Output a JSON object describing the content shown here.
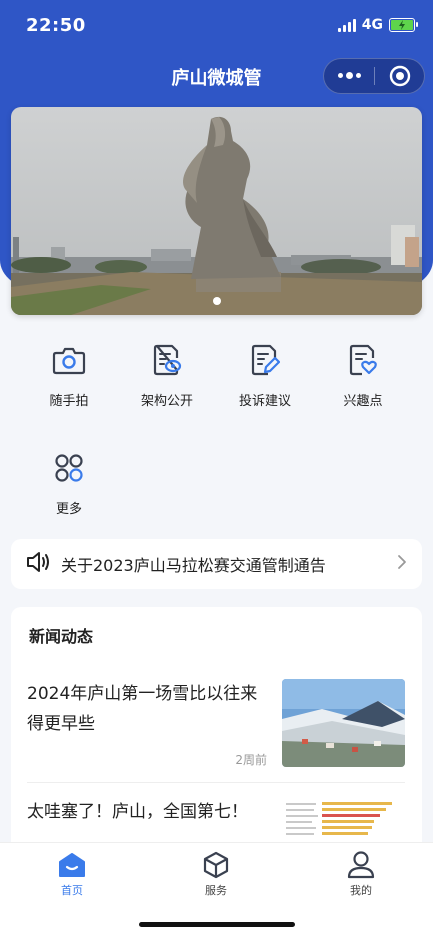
{
  "status_bar": {
    "time": "22:50",
    "network": "4G"
  },
  "header": {
    "title": "庐山微城管"
  },
  "banner": {
    "image": "statue-photo",
    "slides": 1,
    "active_slide": 1
  },
  "services": [
    {
      "label": "随手拍",
      "icon": "camera-icon"
    },
    {
      "label": "架构公开",
      "icon": "document-eye-icon"
    },
    {
      "label": "投诉建议",
      "icon": "document-pen-icon"
    },
    {
      "label": "兴趣点",
      "icon": "document-heart-icon"
    },
    {
      "label": "更多",
      "icon": "grid-more-icon"
    }
  ],
  "notice": {
    "text": "关于2023庐山马拉松赛交通管制通告"
  },
  "news": {
    "heading": "新闻动态",
    "items": [
      {
        "title": "2024年庐山第一场雪比以往来得更早些",
        "time": "2周前"
      },
      {
        "title": "太哇塞了！庐山，全国第七！",
        "time": ""
      }
    ]
  },
  "tabbar": {
    "tabs": [
      {
        "label": "首页",
        "icon": "home-icon",
        "active": true
      },
      {
        "label": "服务",
        "icon": "cube-icon",
        "active": false
      },
      {
        "label": "我的",
        "icon": "user-icon",
        "active": false
      }
    ]
  },
  "colors": {
    "primary": "#2f56c6",
    "accent": "#3a7bea",
    "background": "#f4f6fa"
  }
}
